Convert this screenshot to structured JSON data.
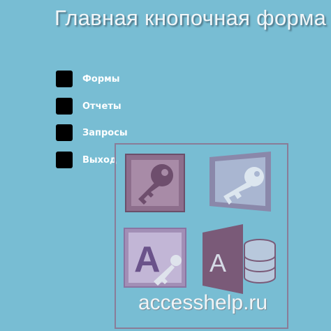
{
  "header": {
    "title": "Главная кнопочная форма"
  },
  "menu": {
    "items": [
      {
        "label": "Формы"
      },
      {
        "label": "Отчеты"
      },
      {
        "label": "Запросы"
      },
      {
        "label": "Выход"
      }
    ]
  },
  "watermark": {
    "text": "accesshelp.ru"
  },
  "colors": {
    "background": "#78bdd3",
    "button": "#000000",
    "logo_frame": "#8a7c97"
  },
  "icons": [
    "access-2003-key-icon",
    "access-2007-key-icon",
    "access-2010-icon",
    "access-2013-icon"
  ]
}
